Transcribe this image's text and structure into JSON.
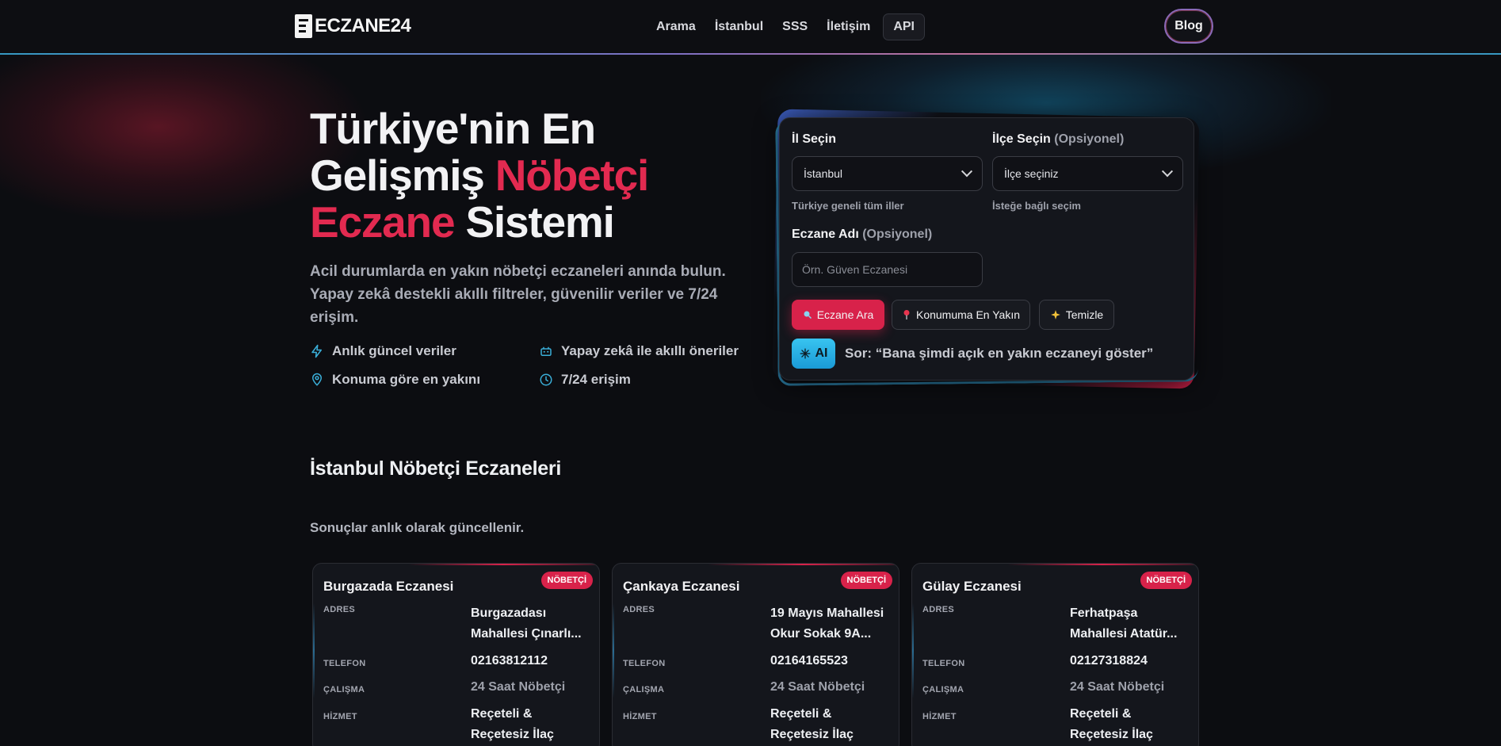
{
  "brand": {
    "name": "ECZANE24"
  },
  "nav": {
    "items": [
      "Arama",
      "İstanbul",
      "SSS",
      "İletişim"
    ],
    "api": "API",
    "blog": "Blog"
  },
  "hero": {
    "title_line1": "Türkiye'nin En",
    "title_line2a": "Gelişmiş ",
    "title_line2b": "Nöbetçi",
    "title_line3a": "Eczane",
    "title_line3b": " Sistemi",
    "subtitle": "Acil durumlarda en yakın nöbetçi eczaneleri anında bulun. Yapay zekâ destekli akıllı filtreler, güvenilir veriler ve 7/24 erişim.",
    "features": [
      {
        "icon": "bolt-icon",
        "label": "Anlık güncel veriler"
      },
      {
        "icon": "robot-icon",
        "label": "Yapay zekâ ile akıllı öneriler"
      },
      {
        "icon": "map-pin-icon",
        "label": "Konuma göre en yakını"
      },
      {
        "icon": "clock-icon",
        "label": "7/24 erişim"
      }
    ]
  },
  "search": {
    "city_label": "İl Seçin",
    "city_value": "İstanbul",
    "city_hint": "Türkiye geneli tüm iller",
    "district_label": "İlçe Seçin",
    "district_optional": "(Opsiyonel)",
    "district_value": "İlçe seçiniz",
    "district_hint": "İsteğe bağlı seçim",
    "name_label": "Eczane Adı",
    "name_optional": "(Opsiyonel)",
    "name_placeholder": "Örn. Güven Eczanesi",
    "search_button": "Eczane Ara",
    "nearest_button": "Konumuma En Yakın",
    "clear_button": "Temizle",
    "ai_badge": "AI",
    "ai_prompt": "Sor: “Bana şimdi açık en yakın eczaneyi göster”"
  },
  "results": {
    "title": "İstanbul Nöbetçi Eczaneleri",
    "subtitle": "Sonuçlar anlık olarak güncellenir.",
    "labels": {
      "address": "ADRES",
      "phone": "TELEFON",
      "hours": "ÇALIŞMA",
      "service": "HİZMET"
    },
    "pharmacies": [
      {
        "name": "Burgazada Eczanesi",
        "badge": "NÖBETÇİ",
        "address_line1": "Burgazadası",
        "address_line2": "Mahallesi Çınarlı...",
        "phone": "02163812112",
        "hours": "24 Saat Nöbetçi",
        "service_line1": "Reçeteli &",
        "service_line2": "Reçetesiz İlaç"
      },
      {
        "name": "Çankaya Eczanesi",
        "badge": "NÖBETÇİ",
        "address_line1": "19 Mayıs Mahallesi",
        "address_line2": "Okur Sokak 9A...",
        "phone": "02164165523",
        "hours": "24 Saat Nöbetçi",
        "service_line1": "Reçeteli &",
        "service_line2": "Reçetesiz İlaç"
      },
      {
        "name": "Gülay Eczanesi",
        "badge": "NÖBETÇİ",
        "address_line1": "Ferhatpaşa",
        "address_line2": "Mahallesi Atatür...",
        "phone": "02127318824",
        "hours": "24 Saat Nöbetçi",
        "service_line1": "Reçeteli &",
        "service_line2": "Reçetesiz İlaç"
      }
    ]
  },
  "colors": {
    "accent": "#d8224a",
    "ai": "#29b3e6",
    "background": "#0c0d11"
  }
}
